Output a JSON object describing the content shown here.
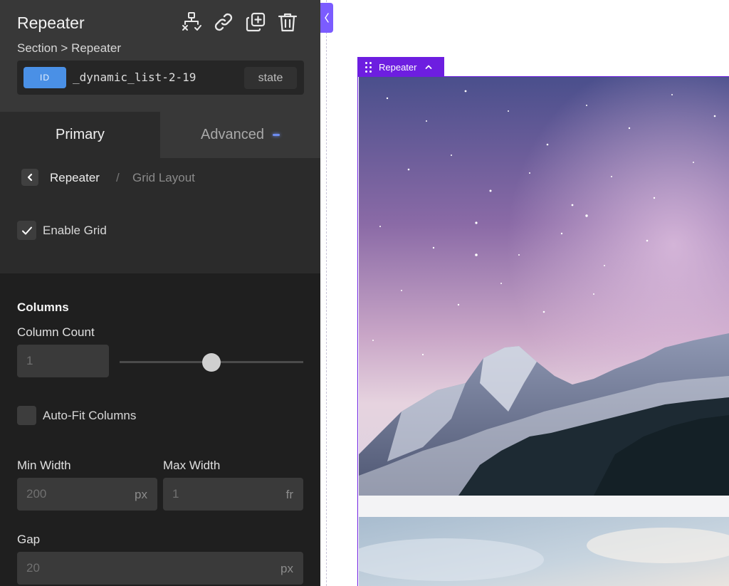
{
  "panel": {
    "title": "Repeater",
    "breadcrumb": "Section > Repeater",
    "icons": [
      "structure-icon",
      "link-icon",
      "duplicate-icon",
      "trash-icon"
    ],
    "id_badge": "ID",
    "id_value": "_dynamic_list-2-19",
    "state_label": "state"
  },
  "tabs": [
    {
      "label": "Primary",
      "active": true
    },
    {
      "label": "Advanced",
      "active": false
    }
  ],
  "subnav": {
    "parent": "Repeater",
    "separator": "/",
    "current": "Grid Layout"
  },
  "enable_grid": {
    "label": "Enable Grid",
    "checked": true
  },
  "columns": {
    "section_title": "Columns",
    "column_count_label": "Column Count",
    "column_count_value": "1",
    "slider_fraction": 0.5,
    "auto_fit_label": "Auto-Fit Columns",
    "auto_fit_checked": false,
    "min_width_label": "Min Width",
    "min_width_value": "200",
    "min_width_unit": "px",
    "max_width_label": "Max Width",
    "max_width_value": "1",
    "max_width_unit": "fr",
    "gap_label": "Gap",
    "gap_value": "20",
    "gap_unit": "px"
  },
  "canvas": {
    "element_tag": "Repeater"
  },
  "colors": {
    "accent": "#6d1ee0",
    "panel_bg": "#1f1f1f",
    "id_badge": "#4a90e6"
  }
}
